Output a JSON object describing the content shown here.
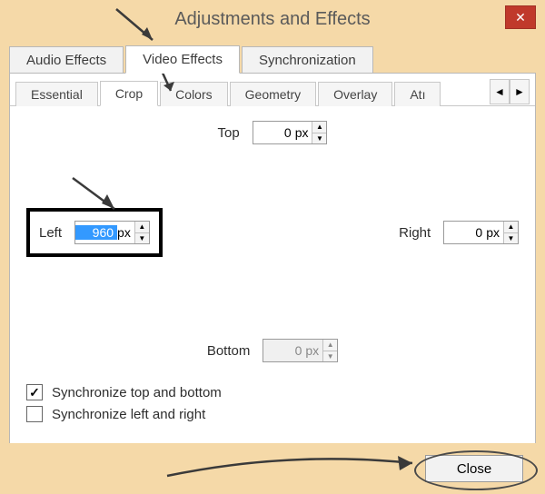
{
  "window": {
    "title": "Adjustments and Effects",
    "close_icon": "✕"
  },
  "primary_tabs": [
    {
      "id": "audio",
      "label": "Audio Effects",
      "active": false
    },
    {
      "id": "video",
      "label": "Video Effects",
      "active": true
    },
    {
      "id": "sync",
      "label": "Synchronization",
      "active": false
    }
  ],
  "sub_tabs": [
    {
      "id": "essential",
      "label": "Essential",
      "active": false
    },
    {
      "id": "crop",
      "label": "Crop",
      "active": true
    },
    {
      "id": "colors",
      "label": "Colors",
      "active": false
    },
    {
      "id": "geometry",
      "label": "Geometry",
      "active": false
    },
    {
      "id": "overlay",
      "label": "Overlay",
      "active": false
    },
    {
      "id": "atmo",
      "label": "Atı",
      "active": false
    }
  ],
  "sub_tab_scroll": {
    "left": "◄",
    "right": "►"
  },
  "crop": {
    "top": {
      "label": "Top",
      "value": "0",
      "unit": "px",
      "disabled": false
    },
    "left": {
      "label": "Left",
      "value": "960",
      "unit": "px",
      "disabled": false,
      "selected": true
    },
    "right": {
      "label": "Right",
      "value": "0",
      "unit": "px",
      "disabled": false
    },
    "bottom": {
      "label": "Bottom",
      "value": "0",
      "unit": "px",
      "disabled": true
    },
    "sync_tb": {
      "label": "Synchronize top and bottom",
      "checked": true
    },
    "sync_lr": {
      "label": "Synchronize left and right",
      "checked": false
    }
  },
  "footer": {
    "close_label": "Close"
  },
  "spin_glyphs": {
    "up": "▲",
    "down": "▼"
  }
}
